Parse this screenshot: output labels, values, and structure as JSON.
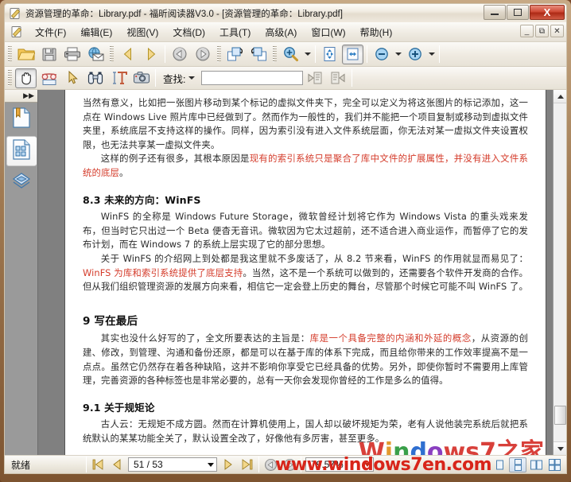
{
  "window": {
    "title": "资源管理的革命：Library.pdf - 福昕阅读器V3.0 - [资源管理的革命：Library.pdf]",
    "icon": "pdf-document-icon",
    "buttons": {
      "minimize": "–",
      "maximize": "□",
      "close": "X"
    }
  },
  "menubar": {
    "icon": "document-icon",
    "items": [
      {
        "label": "文件(F)",
        "mnemonic": "F"
      },
      {
        "label": "编辑(E)",
        "mnemonic": "E"
      },
      {
        "label": "视图(V)",
        "mnemonic": "V"
      },
      {
        "label": "文档(D)",
        "mnemonic": "D"
      },
      {
        "label": "工具(T)",
        "mnemonic": "T"
      },
      {
        "label": "高级(A)",
        "mnemonic": "A"
      },
      {
        "label": "窗口(W)",
        "mnemonic": "W"
      },
      {
        "label": "帮助(H)",
        "mnemonic": "H"
      }
    ],
    "mdi_buttons": [
      "_",
      "⧉",
      "✕"
    ]
  },
  "toolbar_main": {
    "items": [
      {
        "name": "open-file-button",
        "icon": "folder-open-icon"
      },
      {
        "name": "save-button",
        "icon": "floppy-disk-icon"
      },
      {
        "name": "print-button",
        "icon": "printer-icon"
      },
      {
        "name": "email-button",
        "icon": "globe-mail-icon"
      },
      {
        "name": "previous-page-button",
        "icon": "triangle-left-icon"
      },
      {
        "name": "next-page-button",
        "icon": "triangle-right-icon"
      },
      {
        "name": "back-view-button",
        "icon": "circle-arrow-left-icon"
      },
      {
        "name": "forward-view-button",
        "icon": "circle-arrow-right-icon"
      },
      {
        "name": "rotate-clockwise-button",
        "icon": "rotate-cw-page-icon"
      },
      {
        "name": "rotate-counterclockwise-button",
        "icon": "rotate-ccw-page-icon"
      },
      {
        "name": "zoom-tool-button",
        "icon": "magnifier-plus-icon"
      },
      {
        "name": "fit-page-button",
        "icon": "fit-page-icon"
      },
      {
        "name": "fit-width-button",
        "icon": "fit-width-icon"
      },
      {
        "name": "zoom-out-button",
        "icon": "circle-minus-icon"
      },
      {
        "name": "zoom-in-button",
        "icon": "circle-plus-icon"
      }
    ]
  },
  "toolbar_tools": {
    "items": [
      {
        "name": "hand-tool-button",
        "icon": "hand-icon",
        "pressed": true
      },
      {
        "name": "reading-glasses-button",
        "icon": "glasses-icon"
      },
      {
        "name": "select-arrow-button",
        "icon": "cursor-arrow-icon"
      },
      {
        "name": "find-binoculars-button",
        "icon": "binoculars-icon"
      },
      {
        "name": "text-select-button",
        "icon": "text-select-icon"
      },
      {
        "name": "snapshot-button",
        "icon": "camera-icon"
      }
    ],
    "find": {
      "label": "查找:",
      "value": "",
      "placeholder": "",
      "prev_button_icon": "find-previous-icon",
      "next_button_icon": "find-next-icon"
    }
  },
  "navpane": {
    "collapse_icon": "double-chevron-right-icon",
    "tabs": [
      {
        "name": "bookmarks-tab",
        "icon": "bookmark-page-icon",
        "active": false
      },
      {
        "name": "pages-thumbnails-tab",
        "icon": "thumbnails-page-icon",
        "active": true
      },
      {
        "name": "layers-tab",
        "icon": "layers-diamond-icon",
        "active": false
      }
    ]
  },
  "document": {
    "blocks": [
      {
        "type": "para",
        "indent": false,
        "runs": [
          {
            "text": "当然有意义，比如把一张图片移动到某个标记的虚拟文件夹下，完全可以定义为将这张图片的标记添加，这一点在 Windows Live 照片库中已经做到了。然而作为一般性的，我们并不能把一个项目复制或移动到虚拟文件夹里，系统底层不支持这样的操作。同样，因为索引没有进入文件系统层面，你无法对某一虚拟文件夹设置权限，也无法共享某一虚拟文件夹。",
            "color": "normal"
          }
        ]
      },
      {
        "type": "para",
        "indent": true,
        "runs": [
          {
            "text": "这样的例子还有很多，其根本原因是",
            "color": "normal"
          },
          {
            "text": "现有的索引系统只是聚合了库中文件的扩展属性，并没有进入文件系统的底层",
            "color": "red"
          },
          {
            "text": "。",
            "color": "normal"
          }
        ]
      },
      {
        "type": "head",
        "big": false,
        "runs": [
          {
            "text": "8.3 未来的方向：WinFS",
            "color": "normal"
          }
        ]
      },
      {
        "type": "para",
        "indent": true,
        "runs": [
          {
            "text": "WinFS 的全称是 Windows Future Storage，微软曾经计划将它作为 Windows Vista 的重头戏来发布，但当时它只出过一个 Beta 便杳无音讯。微软因为它太过超前，还不适合进入商业运作，而暂停了它的发布计划，而在 Windows 7 的系统上层实现了它的部分思想。",
            "color": "normal"
          }
        ]
      },
      {
        "type": "para",
        "indent": true,
        "runs": [
          {
            "text": "关于 WinFS 的介绍网上到处都是我这里就不多废话了，从 8.2 节来看，WinFS 的作用就显而易见了：",
            "color": "normal"
          },
          {
            "text": "WinFS 为库和索引系统提供了底层支持",
            "color": "red"
          },
          {
            "text": "。当然，这不是一个系统可以做到的，还需要各个软件开发商的合作。但从我们组织管理资源的发展方向来看，相信它一定会登上历史的舞台，尽管那个时候它可能不叫 WinFS 了。",
            "color": "normal"
          }
        ]
      },
      {
        "type": "head",
        "big": true,
        "runs": [
          {
            "text": "9 写在最后",
            "color": "normal"
          }
        ]
      },
      {
        "type": "para",
        "indent": true,
        "runs": [
          {
            "text": "其实也没什么好写的了，全文所要表达的主旨是：",
            "color": "normal"
          },
          {
            "text": "库是一个具备完整的内涵和外延的概念",
            "color": "red"
          },
          {
            "text": "，从资源的创建、修改，到管理、沟通和备份还原，都是可以在基于库的体系下完成，而且给你带来的工作效率提高不是一点点。虽然它仍然存在着各种缺陷，这并不影响你享受它已经具备的优势。另外，即使你暂时不需要用上库管理，完善资源的各种标签也是非常必要的，总有一天你会发现你曾经的工作是多么的值得。",
            "color": "normal"
          }
        ]
      },
      {
        "type": "head",
        "big": false,
        "runs": [
          {
            "text": "9.1 关于规矩论",
            "color": "normal"
          }
        ]
      },
      {
        "type": "para",
        "indent": true,
        "runs": [
          {
            "text": "古人云：无规矩不成方圆。然而在计算机使用上，国人却以破坏规矩为荣，老有人说他装完系统后就把系统默认的某某功能全关了，默认设置全改了，好像他有多厉害，甚至更多。",
            "color": "normal"
          }
        ]
      }
    ],
    "watermark_page": "Windows7之家"
  },
  "scrollbar": {
    "up_icon": "scroll-up-arrow-icon",
    "down_icon": "scroll-down-arrow-icon",
    "thumb": "scroll-thumb"
  },
  "statusbar": {
    "status": "就绪",
    "first_page_icon": "first-page-icon",
    "prev_page_icon": "previous-page-icon",
    "page_value": "51 / 53",
    "next_page_icon": "next-page-icon",
    "last_page_icon": "last-page-icon",
    "back_icon": "history-back-icon",
    "forward_icon": "history-forward-icon",
    "zoom_value": "79.57%",
    "view_modes": [
      {
        "name": "single-page-view",
        "icon": "single-page-icon",
        "active": false
      },
      {
        "name": "continuous-view",
        "icon": "continuous-page-icon",
        "active": true
      },
      {
        "name": "facing-view",
        "icon": "facing-pages-icon",
        "active": false
      },
      {
        "name": "continuous-facing-view",
        "icon": "continuous-facing-icon",
        "active": false
      }
    ],
    "watermark": "www.windows7en.com"
  },
  "colors": {
    "accent_red": "#d8251a",
    "doc_red": "#d43b2a",
    "titlebar_close": "#cf4b36",
    "page_bg": "#ffffff",
    "workspace_bg": "#808080"
  }
}
